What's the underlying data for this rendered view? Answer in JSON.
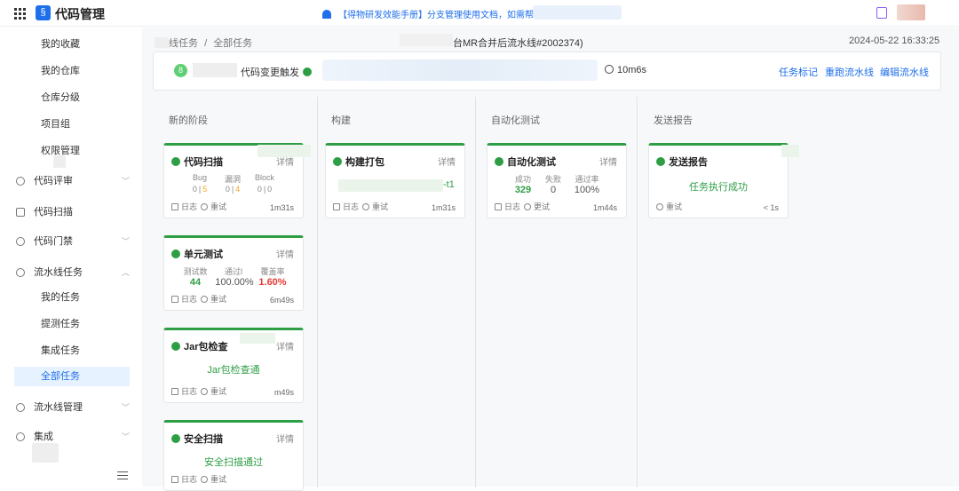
{
  "header": {
    "app_title": "代码管理",
    "logo_glyph": "§",
    "notice": "【得物研发效能手册】分支管理使用文档，如需帮助"
  },
  "sidebar": {
    "sub_items_top": [
      "我的收藏",
      "我的仓库",
      "仓库分级",
      "项目组",
      "权限管理"
    ],
    "groups": [
      {
        "label": "代码评审",
        "icon": "gear-icon"
      },
      {
        "label": "代码扫描",
        "icon": "scan-icon"
      },
      {
        "label": "代码门禁",
        "icon": "shield-icon"
      },
      {
        "label": "流水线任务",
        "icon": "pipeline-icon"
      }
    ],
    "pipeline_sub": [
      "我的任务",
      "提测任务",
      "集成任务",
      "全部任务"
    ],
    "active_item": "全部任务",
    "bottom_groups": [
      {
        "label": "流水线管理",
        "icon": "pipeline-manage-icon"
      },
      {
        "label": "集成",
        "icon": "integration-icon"
      }
    ]
  },
  "main": {
    "breadcrumb_1": "线任务",
    "breadcrumb_sep": "/",
    "breadcrumb_2": "全部任务",
    "pipeline_name": "台MR合并后流水线#2002374)",
    "timestamp": "2024-05-22 16:33:25",
    "user_initial": "8",
    "trigger": "代码变更触发",
    "duration": "10m6s",
    "actions": [
      "任务标记",
      "重跑流水线",
      "编辑流水线"
    ]
  },
  "stages": [
    {
      "title": "新的阶段"
    },
    {
      "title": "构建"
    },
    {
      "title": "自动化测试"
    },
    {
      "title": "发送报告"
    }
  ],
  "cards": {
    "code_scan": {
      "name": "代码扫描",
      "detail": "详情",
      "labels": [
        "Bug",
        "漏洞",
        "Block"
      ],
      "values": [
        [
          "0",
          "5"
        ],
        [
          "0",
          "4"
        ],
        [
          "0",
          "0"
        ]
      ],
      "sep": "|",
      "time": "1m31s"
    },
    "build": {
      "name": "构建打包",
      "detail": "详情",
      "artifact_suffix": "-t1",
      "time": "1m31s"
    },
    "autotest": {
      "name": "自动化测试",
      "detail": "详情",
      "labels": [
        "成功",
        "失败",
        "通过率"
      ],
      "values": [
        "329",
        "0",
        "100%"
      ],
      "time": "1m44s"
    },
    "report": {
      "name": "发送报告",
      "status": "任务执行成功",
      "time": "< 1s"
    },
    "unit_test": {
      "name": "单元测试",
      "detail": "详情",
      "labels": [
        "测试数",
        "通过l",
        "覆盖率"
      ],
      "values": [
        "44",
        "100.00%",
        "1.60%"
      ],
      "time": "6m49s"
    },
    "jar_check": {
      "name": "Jar包检查",
      "detail": "详情",
      "status": "Jar包检查通",
      "time": "m49s"
    },
    "security_scan": {
      "name": "安全扫描",
      "detail": "详情",
      "status": "安全扫描通过"
    }
  },
  "footer": {
    "log_label": "日志",
    "retry_label": "重试",
    "retry_label_alt": "更试"
  },
  "colors": {
    "success": "#2e9e44",
    "danger": "#e53935",
    "warn": "#f5a623",
    "link": "#1f6feb"
  }
}
